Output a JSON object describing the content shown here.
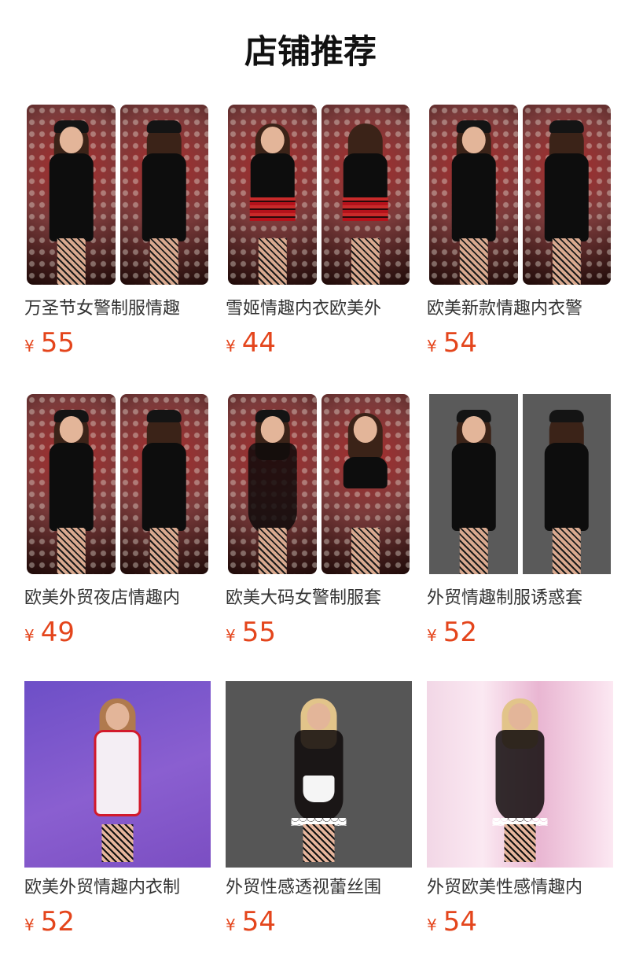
{
  "page": {
    "title": "店铺推荐"
  },
  "accent": "#e4451c",
  "products": [
    {
      "name": "万圣节女警制服情趣",
      "currency": "¥",
      "price": "55",
      "image": "police-costume-black-two-views"
    },
    {
      "name": "雪姬情趣内衣欧美外",
      "currency": "¥",
      "price": "44",
      "image": "plaid-schoolgirl-costume-two-views"
    },
    {
      "name": "欧美新款情趣内衣警",
      "currency": "¥",
      "price": "54",
      "image": "police-dress-costume-two-views"
    },
    {
      "name": "欧美外贸夜店情趣内",
      "currency": "¥",
      "price": "49",
      "image": "lace-police-costume-two-views"
    },
    {
      "name": "欧美大码女警制服套",
      "currency": "¥",
      "price": "55",
      "image": "sheer-police-costume-two-views"
    },
    {
      "name": "外贸情趣制服诱惑套",
      "currency": "¥",
      "price": "52",
      "image": "police-costume-gray-background-two-views"
    },
    {
      "name": "欧美外贸情趣内衣制",
      "currency": "¥",
      "price": "52",
      "image": "nurse-costume"
    },
    {
      "name": "外贸性感透视蕾丝围",
      "currency": "¥",
      "price": "54",
      "image": "maid-costume-dark-background"
    },
    {
      "name": "外贸欧美性感情趣内",
      "currency": "¥",
      "price": "54",
      "image": "maid-costume-pink-background"
    }
  ]
}
